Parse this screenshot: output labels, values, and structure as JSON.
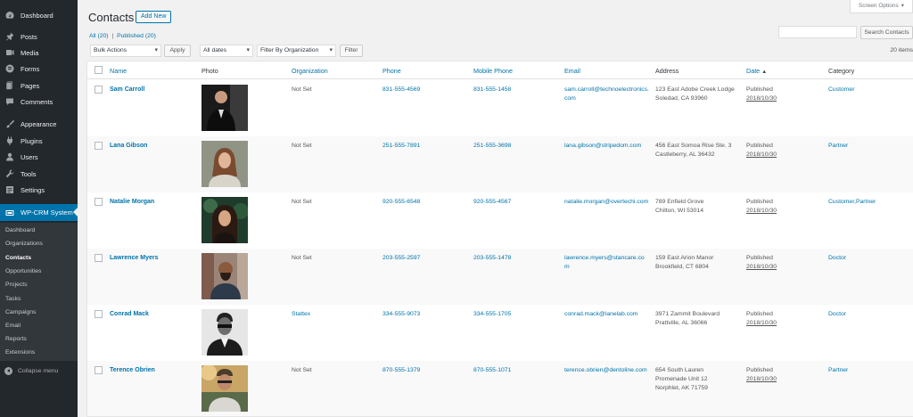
{
  "sidebar": {
    "items": [
      {
        "label": "Dashboard",
        "icon": "dashboard-icon"
      },
      {
        "label": "Posts",
        "icon": "pin-icon"
      },
      {
        "label": "Media",
        "icon": "media-icon"
      },
      {
        "label": "Forms",
        "icon": "forms-icon"
      },
      {
        "label": "Pages",
        "icon": "pages-icon"
      },
      {
        "label": "Comments",
        "icon": "comment-icon"
      },
      {
        "label": "Appearance",
        "icon": "brush-icon"
      },
      {
        "label": "Plugins",
        "icon": "plug-icon"
      },
      {
        "label": "Users",
        "icon": "user-icon"
      },
      {
        "label": "Tools",
        "icon": "wrench-icon"
      },
      {
        "label": "Settings",
        "icon": "settings-icon"
      },
      {
        "label": "WP-CRM System",
        "icon": "crm-icon"
      }
    ],
    "submenu": [
      "Dashboard",
      "Organizations",
      "Contacts",
      "Opportunities",
      "Projects",
      "Tasks",
      "Campaigns",
      "Email",
      "Reports",
      "Extensions"
    ],
    "collapse_label": "Collapse menu"
  },
  "header": {
    "title": "Contacts",
    "add_new": "Add New",
    "screen_options": "Screen Options"
  },
  "filters": {
    "all": "All",
    "all_count": "(20)",
    "sep": "|",
    "published": "Published",
    "published_count": "(20)",
    "bulk_actions": "Bulk Actions",
    "apply": "Apply",
    "all_dates": "All dates",
    "org_filter": "Filter By Organization",
    "filter": "Filter",
    "search_button": "Search Contacts",
    "items_count": "20 items"
  },
  "table": {
    "columns": {
      "name": "Name",
      "photo": "Photo",
      "organization": "Organization",
      "phone": "Phone",
      "mobile": "Mobile Phone",
      "email": "Email",
      "address": "Address",
      "date": "Date",
      "date_sort": "▲",
      "category": "Category"
    },
    "rows": [
      {
        "name": "Sam Carroll",
        "org": "Not Set",
        "phone": "831-555-4569",
        "mobile": "831-555-1458",
        "email": "sam.carroll@technoelectronics.com",
        "addr1": "123 East Adobe Creek Lodge",
        "addr2": "Soledad, CA 93960",
        "addr3": "",
        "status": "Published",
        "date": "2018/10/30",
        "category": "Customer"
      },
      {
        "name": "Lana Gibson",
        "org": "Not Set",
        "phone": "251-555-7891",
        "mobile": "251-555-3698",
        "email": "lana.gibson@stripedom.com",
        "addr1": "456 East Somoa Rise Ste. 3",
        "addr2": "Castleberry, AL 36432",
        "addr3": "",
        "status": "Published",
        "date": "2018/10/30",
        "category": "Partner"
      },
      {
        "name": "Natalie Morgan",
        "org": "Not Set",
        "phone": "920-555-6548",
        "mobile": "920-555-4567",
        "email": "natalie.morgan@overtechi.com",
        "addr1": "789 Enfield Grove",
        "addr2": "Chilton, WI 53014",
        "addr3": "",
        "status": "Published",
        "date": "2018/10/30",
        "category": "Customer,Partner"
      },
      {
        "name": "Lawrence Myers",
        "org": "Not Set",
        "phone": "203-555-2597",
        "mobile": "203-555-1478",
        "email": "lawrence.myers@stancare.com",
        "addr1": "159 East Arion Manor",
        "addr2": "Brookfield, CT 6804",
        "addr3": "",
        "status": "Published",
        "date": "2018/10/30",
        "category": "Doctor"
      },
      {
        "name": "Conrad Mack",
        "org": "Stattex",
        "phone": "334-555-9073",
        "mobile": "334-555-1705",
        "email": "conrad.mack@lanelab.com",
        "addr1": "3971 Zammit Boulevard",
        "addr2": "Prattville, AL 36066",
        "addr3": "",
        "status": "Published",
        "date": "2018/10/30",
        "category": "Doctor"
      },
      {
        "name": "Terence Obrien",
        "org": "Not Set",
        "phone": "870-555-1379",
        "mobile": "870-555-1071",
        "email": "terence.obrien@dentoline.com",
        "addr1": "654 South Lauren",
        "addr2": "Promenade Unit 12",
        "addr3": "Norphlet, AK 71759",
        "status": "Published",
        "date": "2018/10/30",
        "category": "Partner"
      }
    ]
  },
  "colors": {
    "sidebar_bg": "#23282d",
    "active_menu": "#0073aa",
    "link": "#0073aa"
  }
}
